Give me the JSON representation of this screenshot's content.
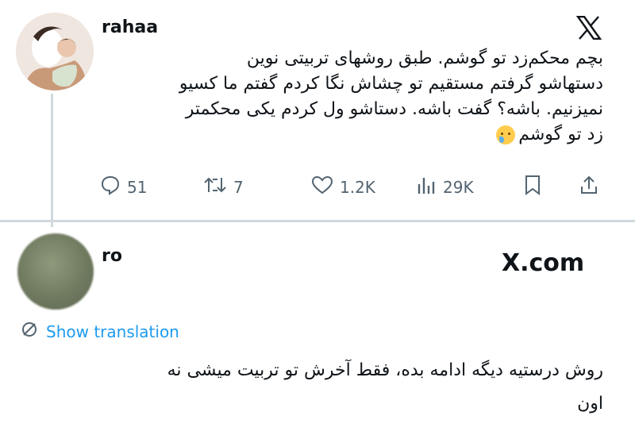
{
  "tweet": {
    "username": "rahaa",
    "text_lines": [
      "بچم محکم‌زد تو گوشم. طبق روشهای تربیتی نوین",
      "دستهاشو گرفتم مستقیم تو چشاش نگا کردم گفتم ما کسیو",
      "نمیزنیم. باشه؟ گفت باشه. دستاشو ول کردم یکی محکمتر",
      "زد تو گوشم"
    ],
    "emoji": "face-holding-back-tears-emoji",
    "actions": {
      "replies": "51",
      "retweets": "7",
      "likes": "1.2K",
      "views": "29K"
    }
  },
  "reply": {
    "username": "ro",
    "watermark": "X.com",
    "show_translation": "Show translation",
    "text_lines": [
      "روش درستیه دیگه ادامه بده، فقط آخرش تو تربیت میشی نه",
      "اون"
    ]
  },
  "icons": {
    "logo": "x-logo-icon",
    "reply": "reply-icon",
    "retweet": "retweet-icon",
    "like": "heart-icon",
    "views": "views-icon",
    "bookmark": "bookmark-icon",
    "share": "share-icon",
    "translate": "translate-icon"
  },
  "colors": {
    "text": "#0f1419",
    "secondary": "#536471",
    "link": "#1d9bf0",
    "divider": "#cfd9de"
  }
}
